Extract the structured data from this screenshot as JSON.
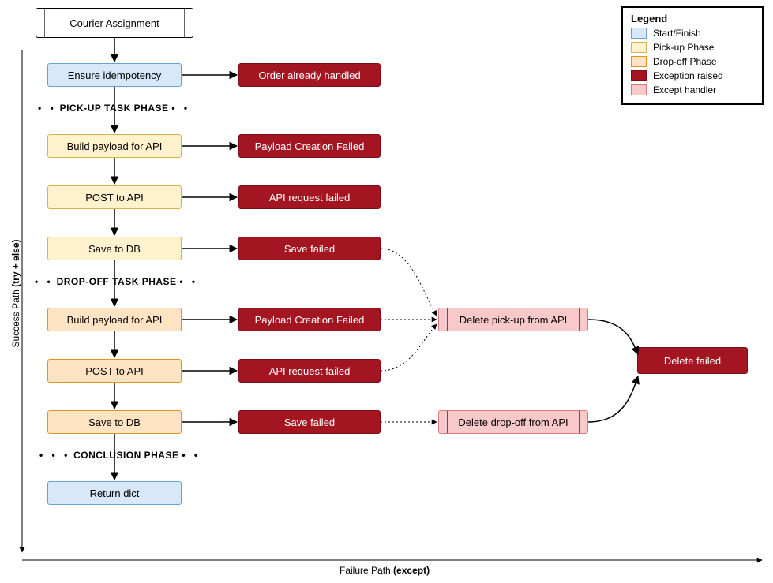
{
  "title_node": "Courier Assignment",
  "col1": {
    "idempotency": "Ensure idempotency",
    "pickup_build": "Build payload for API",
    "pickup_post": "POST to API",
    "pickup_save": "Save to DB",
    "dropoff_build": "Build payload for API",
    "dropoff_post": "POST to API",
    "dropoff_save": "Save to DB",
    "return": "Return dict"
  },
  "col2": {
    "already": "Order already handled",
    "pickup_payload_fail": "Payload Creation Failed",
    "pickup_api_fail": "API request failed",
    "pickup_save_fail": "Save failed",
    "dropoff_payload_fail": "Payload Creation Failed",
    "dropoff_api_fail": "API request failed",
    "dropoff_save_fail": "Save failed"
  },
  "handlers": {
    "delete_pickup": "Delete pick-up from API",
    "delete_dropoff": "Delete drop-off from API",
    "delete_failed": "Delete failed"
  },
  "phases": {
    "pickup": "PICK-UP TASK PHASE",
    "dropoff": "DROP-OFF TASK PHASE",
    "conclusion": "CONCLUSION PHASE"
  },
  "legend": {
    "title": "Legend",
    "start": "Start/Finish",
    "pickup": "Pick-up Phase",
    "dropoff": "Drop-off Phase",
    "exception": "Exception raised",
    "handler": "Except handler"
  },
  "axes": {
    "y_pre": "Success Path ",
    "y_bold": "(try + else)",
    "x_pre": "Failure Path ",
    "x_bold": "(except)"
  },
  "chart_data": {
    "type": "flowchart",
    "direction": "TB",
    "nodes": [
      {
        "id": "start",
        "label": "Courier Assignment",
        "class": "start"
      },
      {
        "id": "idem",
        "label": "Ensure idempotency",
        "class": "start-finish"
      },
      {
        "id": "p_build",
        "label": "Build payload for API",
        "class": "pickup"
      },
      {
        "id": "p_post",
        "label": "POST to API",
        "class": "pickup"
      },
      {
        "id": "p_save",
        "label": "Save to DB",
        "class": "pickup"
      },
      {
        "id": "d_build",
        "label": "Build payload for API",
        "class": "dropoff"
      },
      {
        "id": "d_post",
        "label": "POST to API",
        "class": "dropoff"
      },
      {
        "id": "d_save",
        "label": "Save to DB",
        "class": "dropoff"
      },
      {
        "id": "ret",
        "label": "Return dict",
        "class": "start-finish"
      },
      {
        "id": "e_already",
        "label": "Order already handled",
        "class": "exception"
      },
      {
        "id": "e_p_payload",
        "label": "Payload Creation Failed",
        "class": "exception"
      },
      {
        "id": "e_p_api",
        "label": "API request failed",
        "class": "exception"
      },
      {
        "id": "e_p_save",
        "label": "Save failed",
        "class": "exception"
      },
      {
        "id": "e_d_payload",
        "label": "Payload Creation Failed",
        "class": "exception"
      },
      {
        "id": "e_d_api",
        "label": "API request failed",
        "class": "exception"
      },
      {
        "id": "e_d_save",
        "label": "Save failed",
        "class": "exception"
      },
      {
        "id": "h_del_pick",
        "label": "Delete pick-up from API",
        "class": "handler"
      },
      {
        "id": "h_del_drop",
        "label": "Delete drop-off from API",
        "class": "handler"
      },
      {
        "id": "e_del_fail",
        "label": "Delete failed",
        "class": "exception"
      }
    ],
    "edges": [
      {
        "from": "start",
        "to": "idem",
        "style": "solid"
      },
      {
        "from": "idem",
        "to": "p_build",
        "style": "solid"
      },
      {
        "from": "p_build",
        "to": "p_post",
        "style": "solid"
      },
      {
        "from": "p_post",
        "to": "p_save",
        "style": "solid"
      },
      {
        "from": "p_save",
        "to": "d_build",
        "style": "solid"
      },
      {
        "from": "d_build",
        "to": "d_post",
        "style": "solid"
      },
      {
        "from": "d_post",
        "to": "d_save",
        "style": "solid"
      },
      {
        "from": "d_save",
        "to": "ret",
        "style": "solid"
      },
      {
        "from": "idem",
        "to": "e_already",
        "style": "solid"
      },
      {
        "from": "p_build",
        "to": "e_p_payload",
        "style": "solid"
      },
      {
        "from": "p_post",
        "to": "e_p_api",
        "style": "solid"
      },
      {
        "from": "p_save",
        "to": "e_p_save",
        "style": "solid"
      },
      {
        "from": "d_build",
        "to": "e_d_payload",
        "style": "solid"
      },
      {
        "from": "d_post",
        "to": "e_d_api",
        "style": "solid"
      },
      {
        "from": "d_save",
        "to": "e_d_save",
        "style": "solid"
      },
      {
        "from": "e_p_save",
        "to": "h_del_pick",
        "style": "dotted"
      },
      {
        "from": "e_d_payload",
        "to": "h_del_pick",
        "style": "dotted"
      },
      {
        "from": "e_d_api",
        "to": "h_del_pick",
        "style": "dotted"
      },
      {
        "from": "e_d_save",
        "to": "h_del_drop",
        "style": "dotted"
      },
      {
        "from": "h_del_pick",
        "to": "e_del_fail",
        "style": "solid"
      },
      {
        "from": "h_del_drop",
        "to": "e_del_fail",
        "style": "solid"
      }
    ],
    "groups": [
      {
        "label": "PICK-UP TASK PHASE",
        "nodes": [
          "p_build",
          "p_post",
          "p_save"
        ]
      },
      {
        "label": "DROP-OFF TASK PHASE",
        "nodes": [
          "d_build",
          "d_post",
          "d_save"
        ]
      },
      {
        "label": "CONCLUSION PHASE",
        "nodes": [
          "ret"
        ]
      }
    ],
    "axes": {
      "y": "Success Path (try + else)",
      "x": "Failure Path (except)"
    }
  }
}
